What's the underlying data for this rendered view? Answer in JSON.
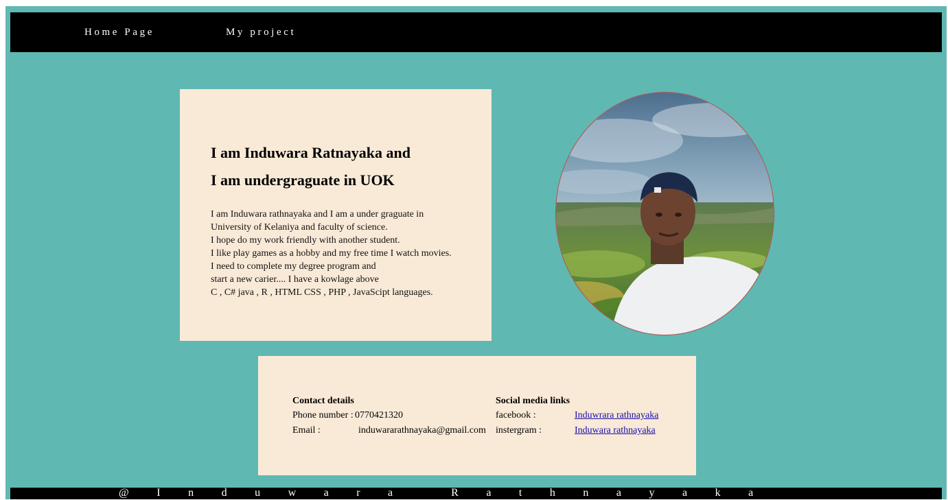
{
  "nav": {
    "home_label": "Home Page",
    "project_label": "My project"
  },
  "intro": {
    "heading_line1": "I am Induwara Ratnayaka and",
    "heading_line2": "I am undergraguate in UOK",
    "bio_lines": [
      "I am Induwara rathnayaka and I am a under graguate in",
      "University of Kelaniya and faculty of science.",
      "I hope do my work friendly with another student.",
      "I like play games as a hobby and my free time I watch movies.",
      "I need to complete my degree program and",
      "start a new carier.... I have a kowlage above",
      "C , C# java , R , HTML CSS , PHP , JavaScipt languages."
    ]
  },
  "contact": {
    "title": "Contact details",
    "phone_label": "Phone number : ",
    "phone_value": "0770421320",
    "email_label": "Email :",
    "email_value": "induwararathnayaka@gmail.com"
  },
  "social": {
    "title": "Social media links",
    "facebook_label": "facebook :",
    "facebook_link": "Induwrara rathnayaka",
    "instagram_label": "instergram :",
    "instagram_link": "Induwara rathnayaka"
  },
  "footer": {
    "text": "@Induwara Rathnayaka"
  },
  "colors": {
    "page_background": "#5fb8b2",
    "bar_background": "#000000",
    "card_background": "#f9ead7",
    "link_color": "#1a0dab",
    "photo_border": "#c0484e"
  },
  "profile_photo": {
    "icon": "profile-photo"
  }
}
